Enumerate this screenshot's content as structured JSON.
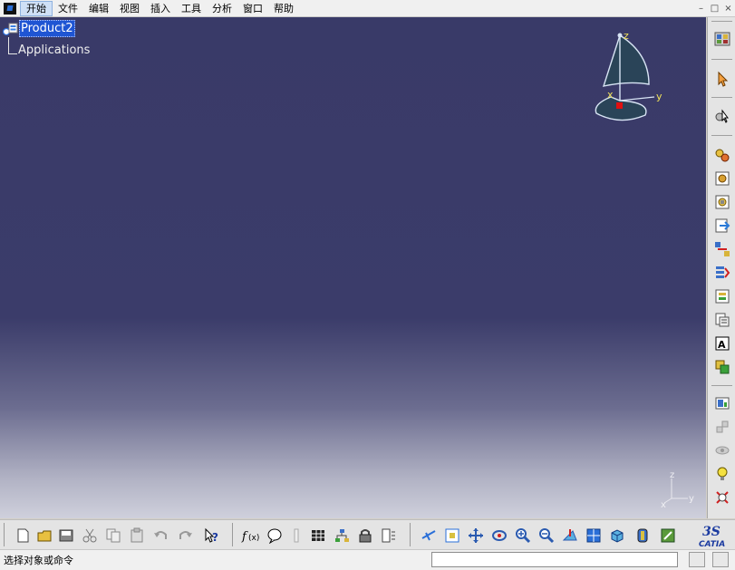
{
  "menu": {
    "items": [
      "开始",
      "文件",
      "编辑",
      "视图",
      "插入",
      "工具",
      "分析",
      "窗口",
      "帮助"
    ],
    "active_index": 0,
    "window_controls": [
      "minimize",
      "restore",
      "close"
    ]
  },
  "tree": {
    "root_label": "Product2",
    "child_label": "Applications"
  },
  "compass": {
    "z": "z",
    "y": "y",
    "x": "x"
  },
  "axis_triad": {
    "z": "z",
    "y": "y",
    "x": "x"
  },
  "status": {
    "prompt": "选择对象或命令",
    "command_value": ""
  },
  "colors": {
    "viewport_top": "#393a68",
    "viewport_bottom": "#cfd0dc",
    "selection": "#1f55d3"
  },
  "right_toolbar_icons": [
    "catalog-browser-icon",
    "select-icon",
    "fly-mode-icon",
    "insert-new-component-icon",
    "insert-new-product-icon",
    "insert-new-part-icon",
    "insert-existing-component-icon",
    "replace-component-icon",
    "graph-tree-reordering-icon",
    "generate-numbering-icon",
    "selective-load-icon",
    "manage-representations-icon",
    "multi-instantiation-icon",
    "scenes-icon",
    "exploded-view-icon",
    "clash-icon",
    "sectioning-icon",
    "measure-icon",
    "hide-show-icon"
  ],
  "bottom_toolbar_icons": [
    "new-icon",
    "open-icon",
    "save-icon",
    "print-icon",
    "cut-icon",
    "copy-icon",
    "paste-icon",
    "undo-icon",
    "redo-icon",
    "whats-this-icon",
    "formula-icon",
    "comment-icon",
    "ruler-icon",
    "table-icon",
    "tree-icon",
    "lock-icon",
    "stack-icon",
    "fly-icon",
    "fit-all-icon",
    "pan-icon",
    "rotate-icon",
    "zoom-in-icon",
    "zoom-out-icon",
    "normal-view-icon",
    "multi-view-icon",
    "iso-view-icon",
    "shading-icon",
    "hide-show-icon",
    "swap-visible-space-icon"
  ]
}
